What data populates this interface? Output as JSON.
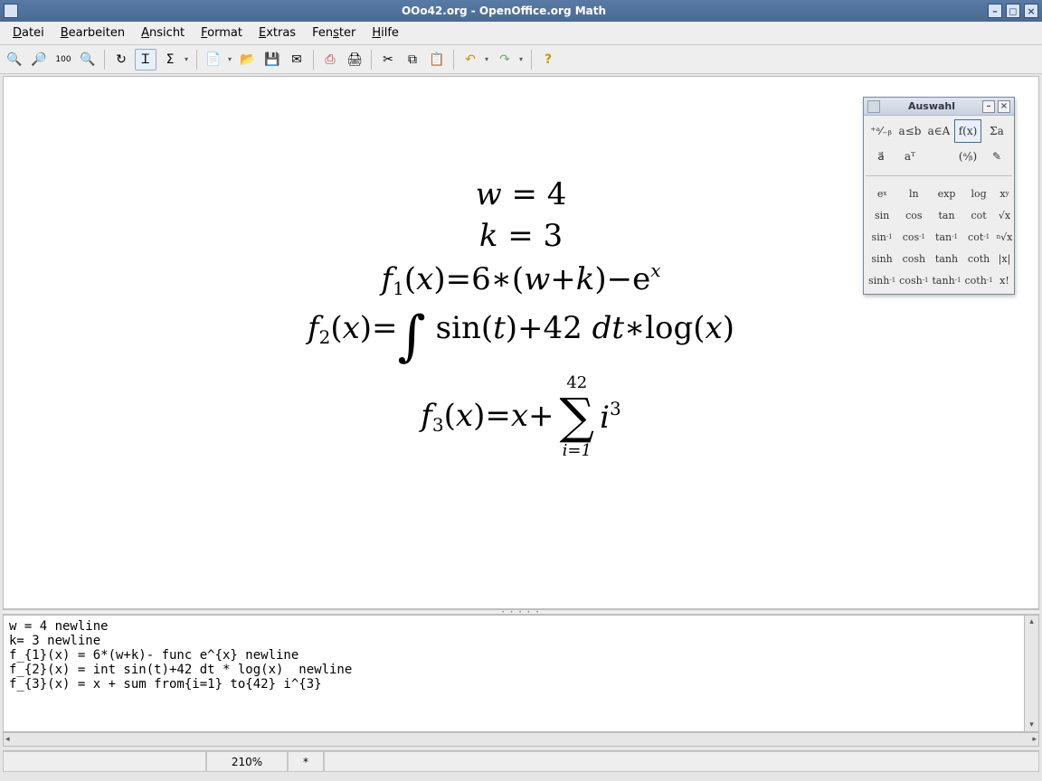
{
  "titlebar": {
    "title": "OOo42.org - OpenOffice.org Math"
  },
  "menu": {
    "datei": "Datei",
    "bearbeiten": "Bearbeiten",
    "ansicht": "Ansicht",
    "format": "Format",
    "extras": "Extras",
    "fenster": "Fenster",
    "hilfe": "Hilfe"
  },
  "formula": {
    "line1": "w = 4",
    "line2": "k = 3",
    "line3": "f₁(x) = 6∗(w+k) − eˣ",
    "line4": "f₂(x) = ∫ sin(t) + 42 dt ∗ log(x)",
    "line5": "f₃(x) = x + Σ (i=1..42) i³",
    "sum_lower": "i=1",
    "sum_upper": "42"
  },
  "editor": {
    "content": "w = 4 newline\nk= 3 newline\nf_{1}(x) = 6*(w+k)- func e^{x} newline\nf_{2}(x) = int sin(t)+42 dt * log(x)  newline\nf_{3}(x) = x + sum from{i=1} to{42} i^{3}"
  },
  "status": {
    "zoom": "210%",
    "modified": "*"
  },
  "palette": {
    "title": "Auswahl",
    "row1": [
      "⁺ᵃ⁄₋ᵦ",
      "a≤b",
      "a∈A",
      "f(x)",
      "Σa"
    ],
    "row2": [
      "a⃗",
      "aᵀ",
      "",
      "(ᵃ⁄ᵦ)",
      "✎"
    ],
    "funcs": [
      [
        "eˣ",
        "ln",
        "exp",
        "log",
        "xʸ"
      ],
      [
        "sin",
        "cos",
        "tan",
        "cot",
        "√x"
      ],
      [
        "sin⁻¹",
        "cos⁻¹",
        "tan⁻¹",
        "cot⁻¹",
        "ⁿ√x"
      ],
      [
        "sinh",
        "cosh",
        "tanh",
        "coth",
        "|x|"
      ],
      [
        "sinh⁻¹",
        "cosh⁻¹",
        "tanh⁻¹",
        "coth⁻¹",
        "x!"
      ]
    ],
    "selected_cat_index": 3
  }
}
